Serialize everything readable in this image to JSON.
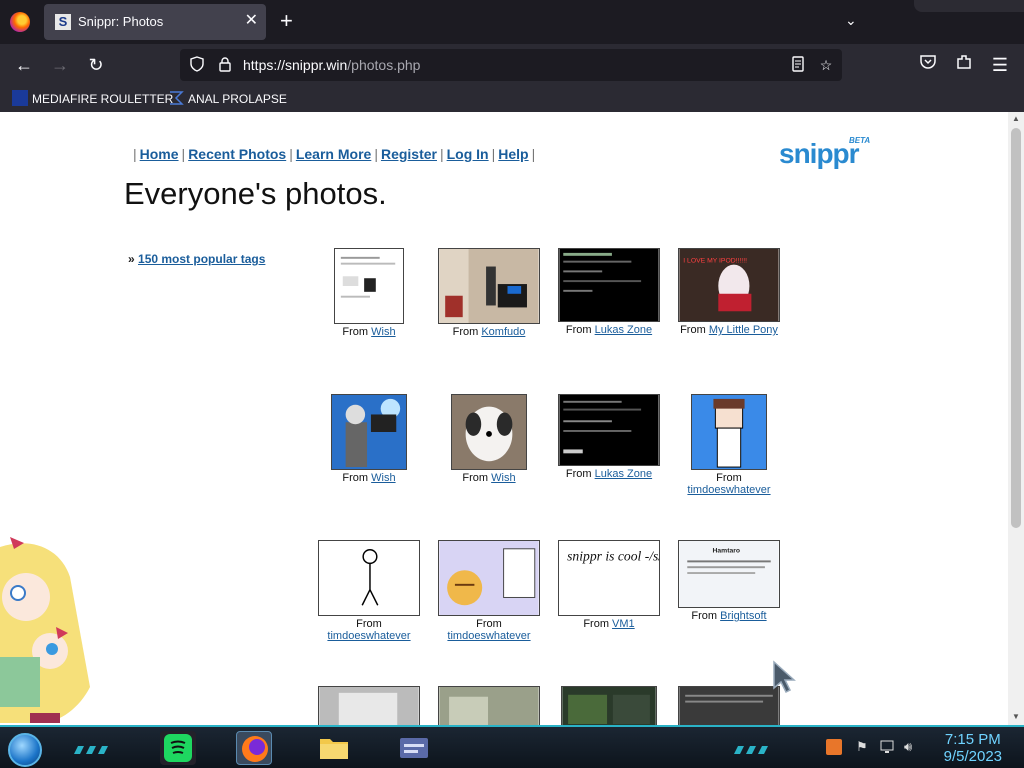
{
  "browser": {
    "tab_title": "Snippr: Photos",
    "tab_favicon": "S",
    "url_host": "https://snippr.win",
    "url_path": "/photos.php",
    "bookmarks": [
      {
        "label": "MEDIAFIRE ROULETTER"
      },
      {
        "label": "ANAL PROLAPSE"
      }
    ]
  },
  "site": {
    "nav": [
      "Home",
      "Recent Photos",
      "Learn More",
      "Register",
      "Log In",
      "Help"
    ],
    "logo": "snippr",
    "logo_badge": "BETA",
    "title": "Everyone's photos.",
    "tags_prefix": "»",
    "tags_link": "150 most popular tags"
  },
  "photos": [
    {
      "from": "From",
      "source": "Wish"
    },
    {
      "from": "From",
      "source": "Komfudo"
    },
    {
      "from": "From",
      "source": "Lukas Zone"
    },
    {
      "from": "From",
      "source": "My Little Pony"
    },
    {
      "from": "From",
      "source": "Wish"
    },
    {
      "from": "From",
      "source": "Wish"
    },
    {
      "from": "From",
      "source": "Lukas Zone"
    },
    {
      "from": "From",
      "source": "timdoeswhatever"
    },
    {
      "from": "From",
      "source": "timdoeswhatever"
    },
    {
      "from": "From",
      "source": "timdoeswhatever"
    },
    {
      "from": "From",
      "source": "VM1"
    },
    {
      "from": "From",
      "source": "Brightsoft"
    }
  ],
  "photo_texts": {
    "snippr_note": "snippr is cool -/s/",
    "ipod_caption": "I LOVE MY IPOD!!!!!!",
    "hamtaro": "Hamtaro"
  },
  "taskbar": {
    "time": "7:15 PM",
    "date": "9/5/2023"
  },
  "colors": {
    "link": "#1a5d9b",
    "accent": "#2ab3c7",
    "logo": "#2a8ad0"
  }
}
